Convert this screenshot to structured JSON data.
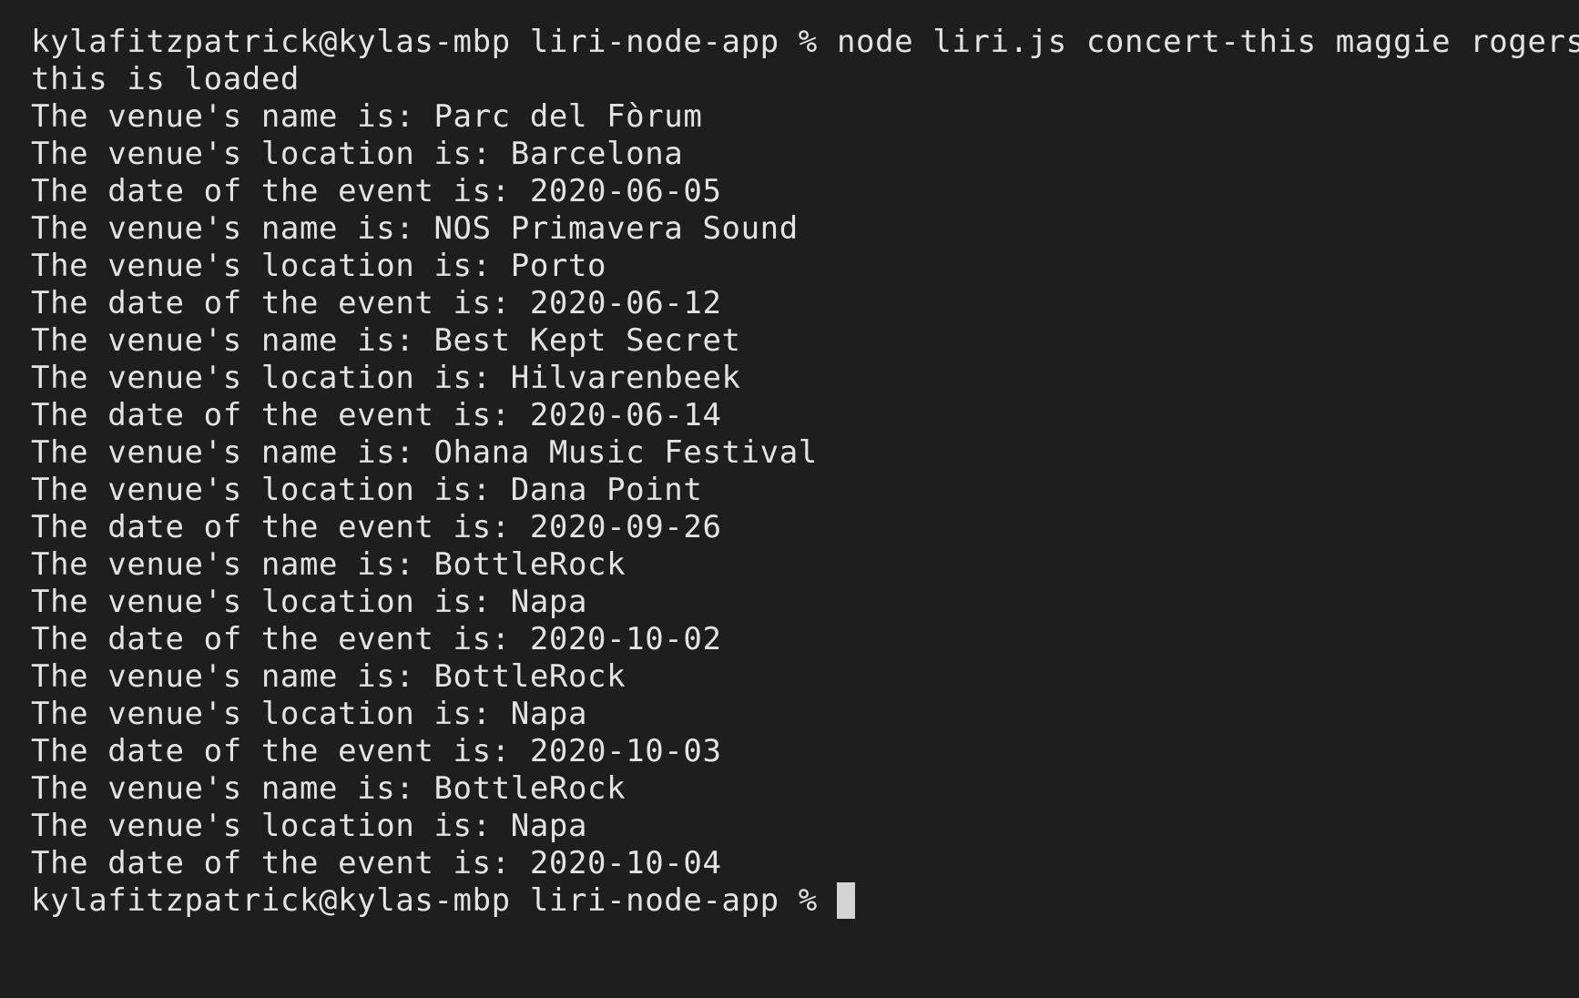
{
  "terminal": {
    "prompt": "kylafitzpatrick@kylas-mbp liri-node-app % ",
    "command": "node liri.js concert-this maggie rogers",
    "output": [
      "this is loaded",
      "The venue's name is: Parc del Fòrum",
      "The venue's location is: Barcelona",
      "The date of the event is: 2020-06-05",
      "The venue's name is: NOS Primavera Sound",
      "The venue's location is: Porto",
      "The date of the event is: 2020-06-12",
      "The venue's name is: Best Kept Secret",
      "The venue's location is: Hilvarenbeek",
      "The date of the event is: 2020-06-14",
      "The venue's name is: Ohana Music Festival",
      "The venue's location is: Dana Point",
      "The date of the event is: 2020-09-26",
      "The venue's name is: BottleRock",
      "The venue's location is: Napa",
      "The date of the event is: 2020-10-02",
      "The venue's name is: BottleRock",
      "The venue's location is: Napa",
      "The date of the event is: 2020-10-03",
      "The venue's name is: BottleRock",
      "The venue's location is: Napa",
      "The date of the event is: 2020-10-04"
    ],
    "final_prompt": "kylafitzpatrick@kylas-mbp liri-node-app % "
  },
  "colors": {
    "background": "#1e1e1e",
    "text": "#e3e3e3",
    "cursor": "#d4d4d4"
  }
}
